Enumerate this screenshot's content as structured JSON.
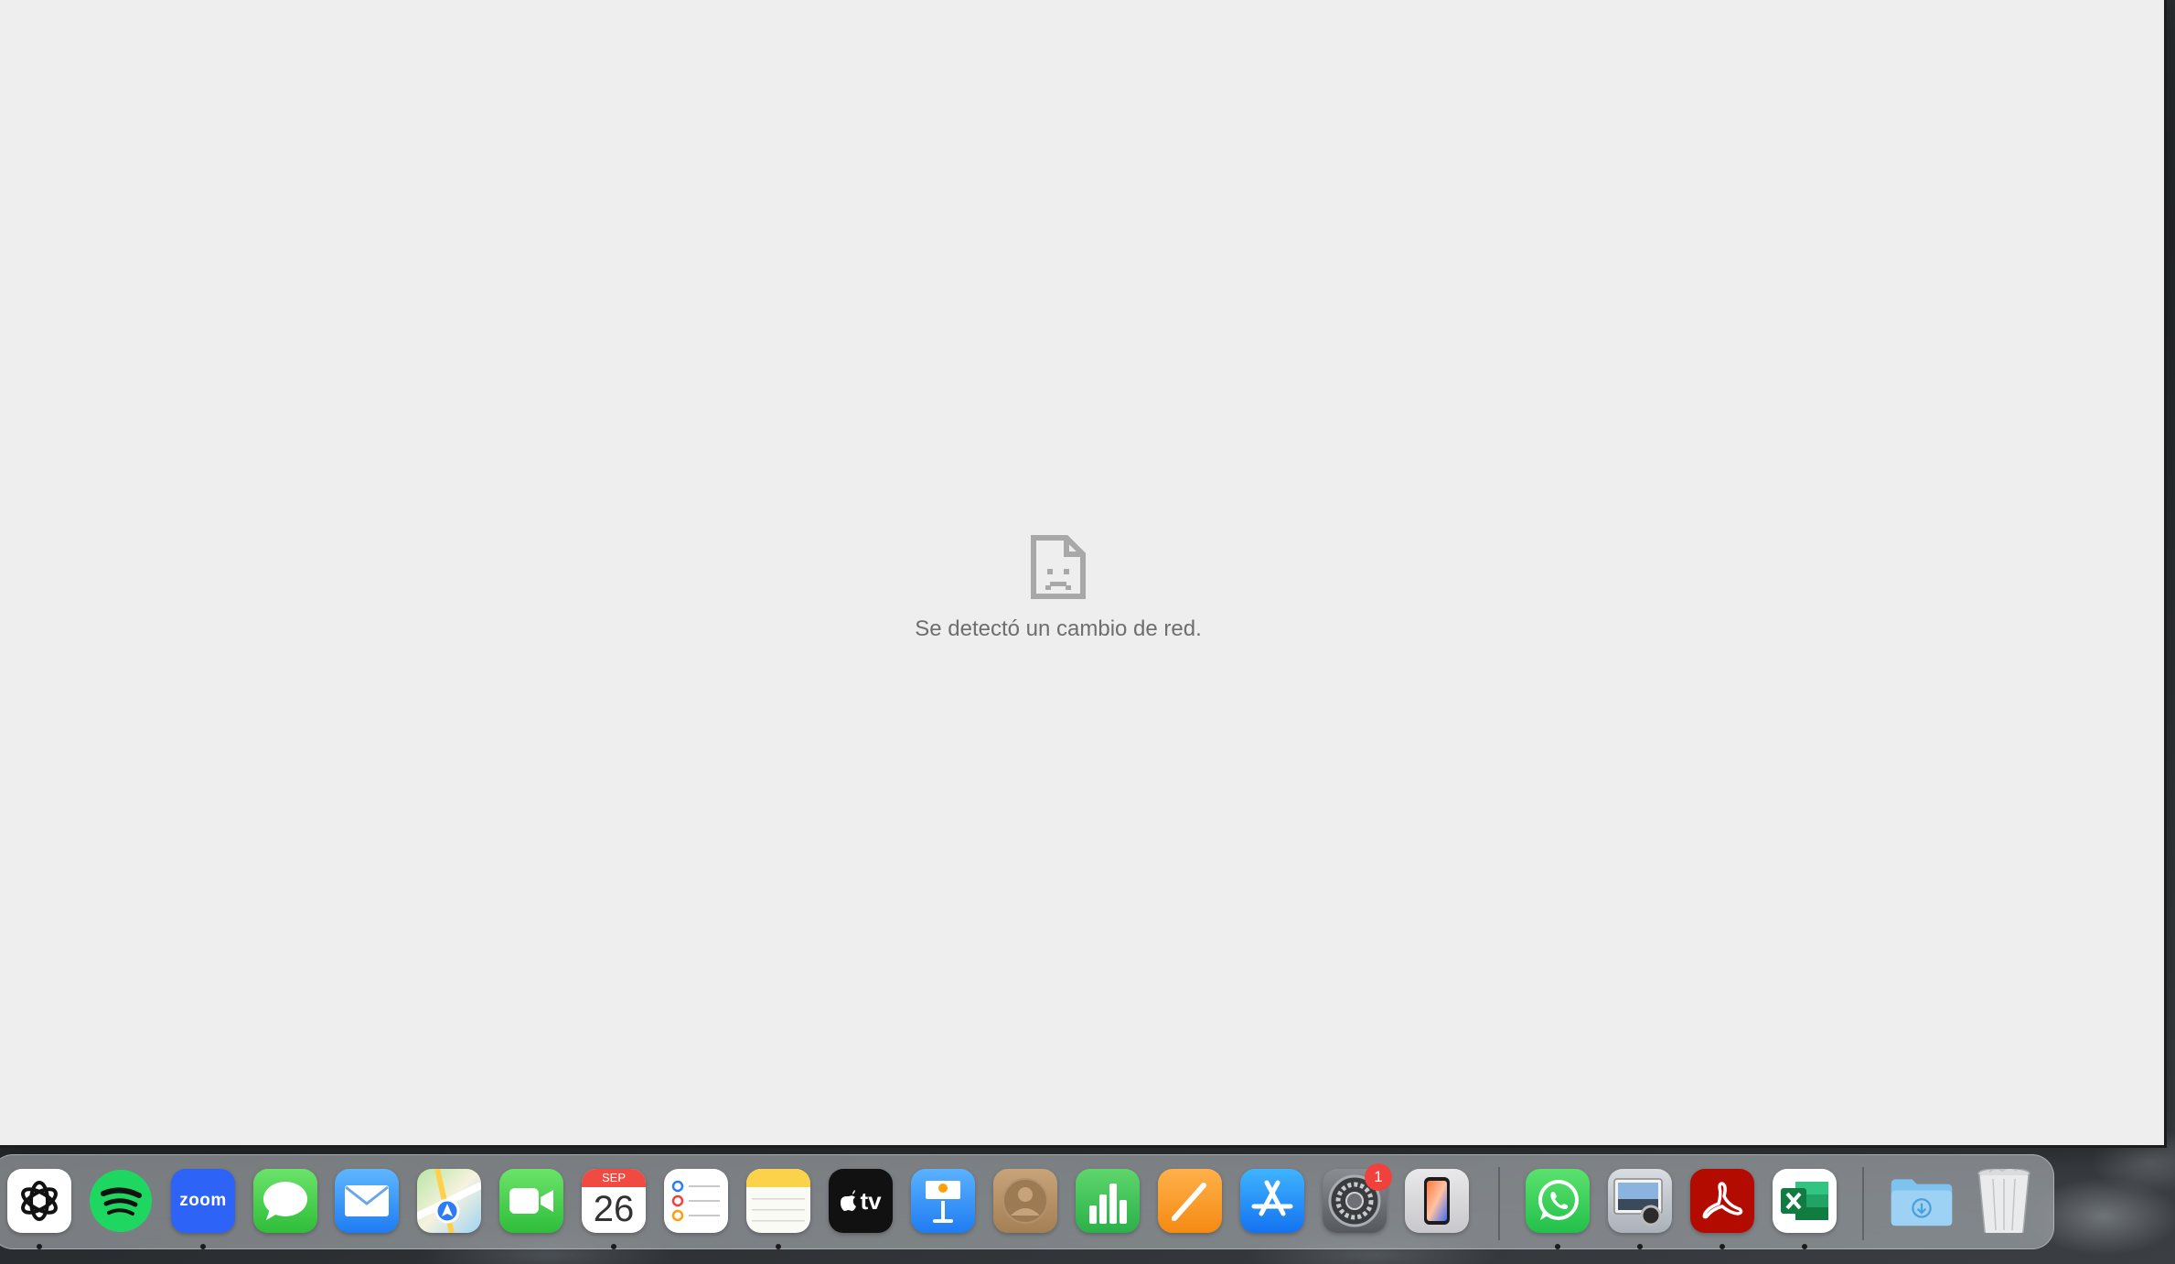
{
  "page": {
    "error_message": "Se detectó un cambio de red."
  },
  "dock": {
    "apps": [
      {
        "name": "ChatGPT",
        "icon": "chatgpt-icon",
        "running": true
      },
      {
        "name": "Spotify",
        "icon": "spotify-icon",
        "running": false
      },
      {
        "name": "Zoom",
        "icon": "zoom-icon",
        "label": "zoom",
        "running": true
      },
      {
        "name": "Messages",
        "icon": "messages-icon",
        "running": false
      },
      {
        "name": "Mail",
        "icon": "mail-icon",
        "running": false
      },
      {
        "name": "Maps",
        "icon": "maps-icon",
        "running": false
      },
      {
        "name": "FaceTime",
        "icon": "facetime-icon",
        "running": false
      },
      {
        "name": "Calendar",
        "icon": "calendar-icon",
        "month": "SEP",
        "day": "26",
        "running": true
      },
      {
        "name": "Reminders",
        "icon": "reminders-icon",
        "running": false
      },
      {
        "name": "Notes",
        "icon": "notes-icon",
        "running": true
      },
      {
        "name": "Apple TV",
        "icon": "appletv-icon",
        "label": "tv",
        "running": false
      },
      {
        "name": "Keynote",
        "icon": "keynote-icon",
        "running": false
      },
      {
        "name": "Contacts",
        "icon": "contacts-icon",
        "running": false
      },
      {
        "name": "Numbers",
        "icon": "numbers-icon",
        "running": false
      },
      {
        "name": "Pages",
        "icon": "pages-icon",
        "running": false
      },
      {
        "name": "App Store",
        "icon": "appstore-icon",
        "running": false
      },
      {
        "name": "System Settings",
        "icon": "settings-icon",
        "badge": "1",
        "running": false
      },
      {
        "name": "iPhone Mirroring",
        "icon": "iphone-mirroring-icon",
        "running": false
      }
    ],
    "recent_apps": [
      {
        "name": "WhatsApp",
        "icon": "whatsapp-icon",
        "running": true
      },
      {
        "name": "Preview",
        "icon": "preview-icon",
        "running": true
      },
      {
        "name": "Adobe Acrobat",
        "icon": "acrobat-icon",
        "running": true
      },
      {
        "name": "Microsoft Excel",
        "icon": "excel-icon",
        "running": true
      }
    ],
    "stacks": [
      {
        "name": "Downloads",
        "icon": "downloads-folder-icon"
      },
      {
        "name": "Trash",
        "icon": "trash-icon"
      }
    ],
    "colors": {
      "spotify": "#1ed760",
      "zoom": "#2d63f6",
      "messages": "#34c759",
      "whatsapp": "#25d366",
      "acrobat": "#b30b00",
      "excel": "#107c41",
      "calendar_red": "#f14a43"
    }
  }
}
